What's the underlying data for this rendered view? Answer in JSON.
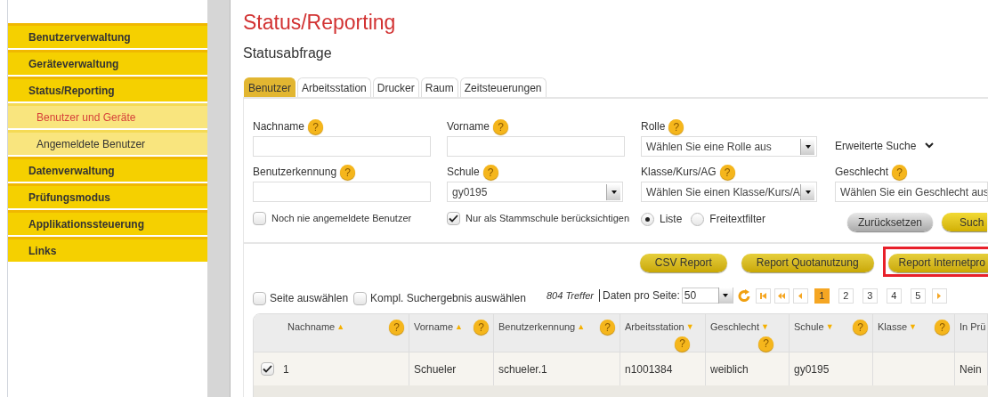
{
  "sidebar": {
    "items": [
      {
        "label": "Benutzerverwaltung",
        "kind": "main",
        "selected": false
      },
      {
        "label": "Geräteverwaltung",
        "kind": "main",
        "selected": false
      },
      {
        "label": "Status/Reporting",
        "kind": "main",
        "selected": false
      },
      {
        "label": "Benutzer und Geräte",
        "kind": "sub",
        "selected": true
      },
      {
        "label": "Angemeldete Benutzer",
        "kind": "sub",
        "selected": false
      },
      {
        "label": "Datenverwaltung",
        "kind": "main",
        "selected": false
      },
      {
        "label": "Prüfungsmodus",
        "kind": "main",
        "selected": false
      },
      {
        "label": "Applikationssteuerung",
        "kind": "main",
        "selected": false
      },
      {
        "label": "Links",
        "kind": "main",
        "selected": false
      }
    ]
  },
  "title": "Status/Reporting",
  "subtitle": "Statusabfrage",
  "tabs": [
    {
      "label": "Benutzer",
      "selected": true
    },
    {
      "label": "Arbeitsstation",
      "selected": false
    },
    {
      "label": "Drucker",
      "selected": false
    },
    {
      "label": "Raum",
      "selected": false
    },
    {
      "label": "Zeitsteuerungen",
      "selected": false
    }
  ],
  "form": {
    "fields": [
      {
        "kind": "text",
        "label": "Nachname",
        "help": "?"
      },
      {
        "kind": "text",
        "label": "Vorname",
        "help": "?"
      },
      {
        "kind": "select",
        "label": "Rolle",
        "help": "?",
        "value": "Wählen Sie eine Rolle aus"
      },
      {
        "kind": "toggle",
        "label": "Erweiterte Suche"
      },
      {
        "kind": "text",
        "label": "Benutzerkennung",
        "help": "?"
      },
      {
        "kind": "select",
        "label": "Schule",
        "help": "?",
        "value": "gy0195"
      },
      {
        "kind": "select",
        "label": "Klasse/Kurs/AG",
        "help": "?",
        "value": "Wählen Sie einen Klasse/Kurs/A"
      },
      {
        "kind": "select",
        "label": "Geschlecht",
        "help": "?",
        "value": "Wählen Sie ein Geschlecht aus"
      },
      {
        "kind": "checkbox",
        "label": "Noch nie angemeldete Benutzer",
        "checked": false
      },
      {
        "kind": "checkbox",
        "label": "Nur als Stammschule berücksichtigen",
        "checked": true
      },
      {
        "kind": "radios",
        "options": [
          {
            "label": "Liste",
            "selected": true
          },
          {
            "label": "Freitextfilter",
            "selected": false
          }
        ]
      },
      {
        "kind": "buttons",
        "buttons": [
          {
            "label": "Zurücksetzen",
            "kind": "secondary"
          },
          {
            "label": "Such",
            "kind": "primary"
          }
        ]
      }
    ]
  },
  "report_buttons": [
    {
      "label": "CSV Report",
      "highlighted": false
    },
    {
      "label": "Report Quotanutzung",
      "highlighted": false
    },
    {
      "label": "Report Internetpro",
      "highlighted": true
    }
  ],
  "selection": [
    {
      "label": "Seite auswählen",
      "checked": false
    },
    {
      "label": "Kompl. Suchergebnis auswählen",
      "checked": false
    }
  ],
  "hits": "804 Treffer",
  "per_page": {
    "label": "Daten pro Seite:",
    "value": "50"
  },
  "pages": [
    {
      "label": "1",
      "selected": true
    },
    {
      "label": "2",
      "selected": false
    },
    {
      "label": "3",
      "selected": false
    },
    {
      "label": "4",
      "selected": false
    },
    {
      "label": "5",
      "selected": false
    }
  ],
  "table": {
    "columns": [
      {
        "label": "Nachname",
        "sort": "▲",
        "help": "?"
      },
      {
        "label": "Vorname",
        "sort": "▲",
        "help": "?"
      },
      {
        "label": "Benutzerkennung",
        "sort": "▲",
        "help": "?"
      },
      {
        "label": "Arbeitsstation",
        "sort": "▼",
        "help": "?"
      },
      {
        "label": "Geschlecht",
        "sort": "▼",
        "help": "?"
      },
      {
        "label": "Schule",
        "sort": "▼",
        "help": "?"
      },
      {
        "label": "Klasse",
        "sort": "▼",
        "help": "?"
      },
      {
        "label": "In Prü"
      }
    ],
    "rows": [
      {
        "checked": true,
        "cells": [
          "1",
          "Schueler",
          "schueler.1",
          "n1001384",
          "weiblich",
          "gy0195",
          null,
          "Nein"
        ]
      }
    ]
  }
}
